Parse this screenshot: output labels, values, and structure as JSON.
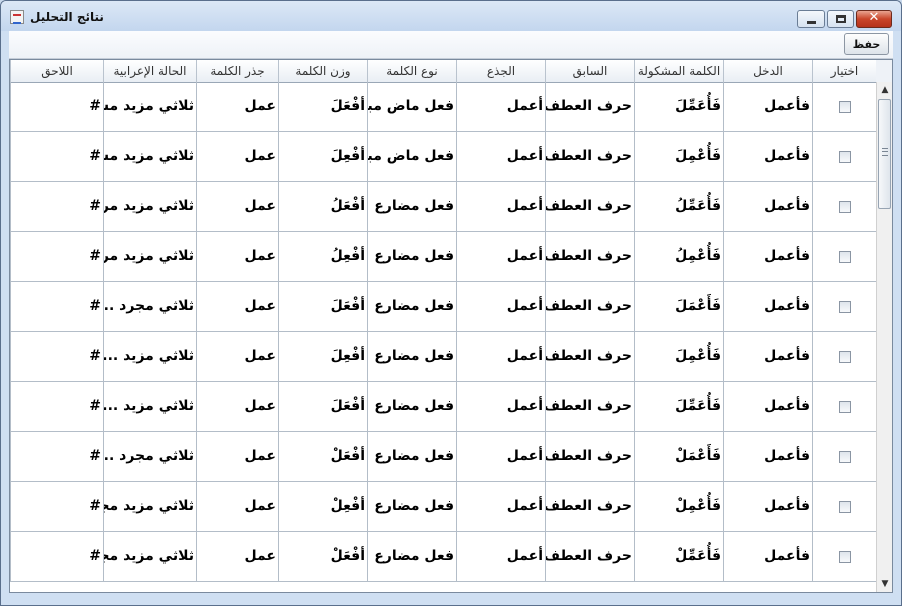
{
  "window": {
    "title": "نتائج التحليل",
    "min_glyph": "",
    "close_glyph": "✕"
  },
  "toolbar": {
    "save_label": "حفظ"
  },
  "table": {
    "columns": [
      "اختيار",
      "الدخل",
      "الكلمة المشكولة",
      "السابق",
      "الجذع",
      "نوع الكلمة",
      "وزن الكلمة",
      "جذر الكلمة",
      "الحالة الإعرابية",
      "اللاحق"
    ],
    "rows": [
      {
        "input": "فأعمل",
        "vocalized": "فَأُعَمِّلَ",
        "prefix": "حرف العطف أو",
        "stem": "أعمل",
        "word_type": "فعل ماض مبني",
        "pattern": "أفْعَلَ",
        "root": "عمل",
        "case": "ثلاثي مزيد مسند",
        "suffix": "#"
      },
      {
        "input": "فأعمل",
        "vocalized": "فَأُعْمِلَ",
        "prefix": "حرف العطف أو",
        "stem": "أعمل",
        "word_type": "فعل ماض مبني",
        "pattern": "أفْعِلَ",
        "root": "عمل",
        "case": "ثلاثي مزيد مسند",
        "suffix": "#"
      },
      {
        "input": "فأعمل",
        "vocalized": "فَأُعَمِّلُ",
        "prefix": "حرف العطف أو",
        "stem": "أعمل",
        "word_type": "فعل مضارع ...",
        "pattern": "أفْعَلُ",
        "root": "عمل",
        "case": "ثلاثي مزيد مرفو",
        "suffix": "#"
      },
      {
        "input": "فأعمل",
        "vocalized": "فَأُعْمِلُ",
        "prefix": "حرف العطف أو",
        "stem": "أعمل",
        "word_type": "فعل مضارع ...",
        "pattern": "أفْعِلُ",
        "root": "عمل",
        "case": "ثلاثي مزيد مرفو",
        "suffix": "#"
      },
      {
        "input": "فأعمل",
        "vocalized": "فَأَعْمَلَ",
        "prefix": "حرف العطف أو",
        "stem": "أعمل",
        "word_type": "فعل مضارع ...",
        "pattern": "أفْعَلَ",
        "root": "عمل",
        "case": "ثلاثي مجرد ...",
        "suffix": "#"
      },
      {
        "input": "فأعمل",
        "vocalized": "فَأُعْمِلَ",
        "prefix": "حرف العطف أو",
        "stem": "أعمل",
        "word_type": "فعل مضارع ...",
        "pattern": "أفْعِلَ",
        "root": "عمل",
        "case": "ثلاثي مزيد ...",
        "suffix": "#"
      },
      {
        "input": "فأعمل",
        "vocalized": "فَأُعَمِّلَ",
        "prefix": "حرف العطف أو",
        "stem": "أعمل",
        "word_type": "فعل مضارع ...",
        "pattern": "أفْعَلَ",
        "root": "عمل",
        "case": "ثلاثي مزيد ...",
        "suffix": "#"
      },
      {
        "input": "فأعمل",
        "vocalized": "فَأَعْمَلْ",
        "prefix": "حرف العطف أو",
        "stem": "أعمل",
        "word_type": "فعل مضارع ...",
        "pattern": "أفْعَلْ",
        "root": "عمل",
        "case": "ثلاثي مجرد ...",
        "suffix": "#"
      },
      {
        "input": "فأعمل",
        "vocalized": "فَأُعْمِلْ",
        "prefix": "حرف العطف أو",
        "stem": "أعمل",
        "word_type": "فعل مضارع ...",
        "pattern": "أفْعِلْ",
        "root": "عمل",
        "case": "ثلاثي مزيد مجز",
        "suffix": "#"
      },
      {
        "input": "فأعمل",
        "vocalized": "فَأُعَمِّلْ",
        "prefix": "حرف العطف أو",
        "stem": "أعمل",
        "word_type": "فعل مضارع ...",
        "pattern": "أفْعَلْ",
        "root": "عمل",
        "case": "ثلاثي مزيد مجز",
        "suffix": "#"
      }
    ]
  },
  "scrollbar": {
    "up_glyph": "▲",
    "down_glyph": "▼",
    "position_fraction": 0.0
  }
}
